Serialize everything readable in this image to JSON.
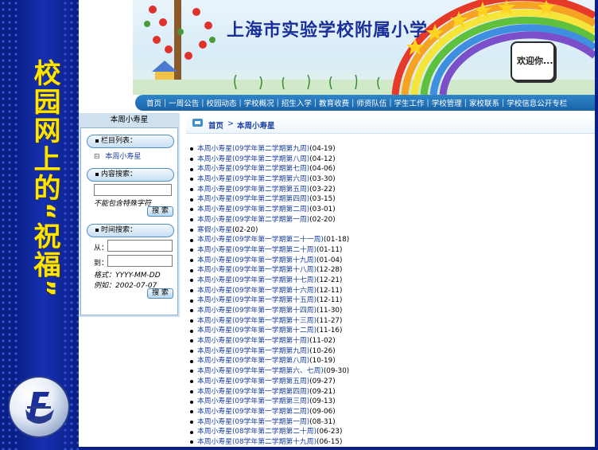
{
  "slide_title": "校园网上的“祝福”",
  "banner": {
    "school_name": "上海市实验学校附属小学",
    "welcome": "欢迎你..."
  },
  "nav": {
    "items": [
      "首页",
      "一周公告",
      "校园动态",
      "学校概况",
      "招生入学",
      "教育收费",
      "师资队伍",
      "学生工作",
      "学校管理",
      "家校联系",
      "学校信息公开专栏"
    ]
  },
  "sidebar": {
    "title": "本周小寿星",
    "category_header": "栏目列表：",
    "category_item": "本周小寿星",
    "content_search_header": "内容搜索：",
    "content_search_value": "",
    "content_search_hint": "不能包含特殊字符",
    "search_button": "搜 索",
    "time_search_header": "时间搜索：",
    "from_label": "从：",
    "to_label": "到：",
    "format_text": "格式：YYYY-MM-DD",
    "example_text": "例如：2002-07-07",
    "search_button_2": "搜 索"
  },
  "breadcrumb": {
    "home": "首页",
    "separator": ">",
    "current": "本周小寿星"
  },
  "articles": [
    {
      "title": "本周小寿星(09学年第二学期第九周)",
      "date": "(04-19)"
    },
    {
      "title": "本周小寿星(09学年第二学期第八周)",
      "date": "(04-12)"
    },
    {
      "title": "本周小寿星(09学年第二学期第七周)",
      "date": "(04-06)"
    },
    {
      "title": "本周小寿星(09学年第二学期第六周)",
      "date": "(03-30)"
    },
    {
      "title": "本周小寿星(09学年第二学期第五周)",
      "date": "(03-22)"
    },
    {
      "title": "本周小寿星(09学年第二学期第四周)",
      "date": "(03-15)"
    },
    {
      "title": "本周小寿星(09学年第二学期第二周)",
      "date": "(03-01)"
    },
    {
      "title": "本周小寿星(09学年第二学期第一周)",
      "date": "(02-20)"
    },
    {
      "title": "寒假小寿星",
      "date": "(02-20)"
    },
    {
      "title": "本周小寿星(09学年第一学期第二十一周)",
      "date": "(01-18)"
    },
    {
      "title": "本周小寿星(09学年第一学期第二十周)",
      "date": "(01-11)"
    },
    {
      "title": "本周小寿星(09学年第一学期第十九周)",
      "date": "(01-04)"
    },
    {
      "title": "本周小寿星(09学年第一学期第十八周)",
      "date": "(12-28)"
    },
    {
      "title": "本周小寿星(09学年第一学期第十七周)",
      "date": "(12-21)"
    },
    {
      "title": "本周小寿星(09学年第一学期第十六周)",
      "date": "(12-11)"
    },
    {
      "title": "本周小寿星(09学年第一学期第十五周)",
      "date": "(12-11)"
    },
    {
      "title": "本周小寿星(09学年第一学期第十四周)",
      "date": "(11-30)"
    },
    {
      "title": "本周小寿星(09学年第一学期第十三周)",
      "date": "(11-27)"
    },
    {
      "title": "本周小寿星(09学年第一学期第十二周)",
      "date": "(11-16)"
    },
    {
      "title": "本周小寿星(09学年第一学期第十周)",
      "date": "(11-02)"
    },
    {
      "title": "本周小寿星(09学年第一学期第九周)",
      "date": "(10-26)"
    },
    {
      "title": "本周小寿星(09学年第一学期第八周)",
      "date": "(10-19)"
    },
    {
      "title": "本周小寿星(09学年第一学期第六、七周)",
      "date": "(09-30)"
    },
    {
      "title": "本周小寿星(09学年第一学期第五周)",
      "date": "(09-27)"
    },
    {
      "title": "本周小寿星(09学年第一学期第四周)",
      "date": "(09-21)"
    },
    {
      "title": "本周小寿星(09学年第一学期第三周)",
      "date": "(09-13)"
    },
    {
      "title": "本周小寿星(09学年第一学期第二周)",
      "date": "(09-06)"
    },
    {
      "title": "本周小寿星(09学年第一学期第一周)",
      "date": "(08-31)"
    },
    {
      "title": "本周小寿星(08学年第二学期第二十周)",
      "date": "(06-23)"
    },
    {
      "title": "本周小寿星(08学年第二学期第十九周)",
      "date": "(06-15)"
    }
  ],
  "colors": {
    "slide_background": "#0a1f86",
    "slide_title": "#ffe400",
    "nav_bar": "#1f6fb5",
    "link": "#1a3fa0",
    "sidebar_bg": "#cfe0ee"
  }
}
